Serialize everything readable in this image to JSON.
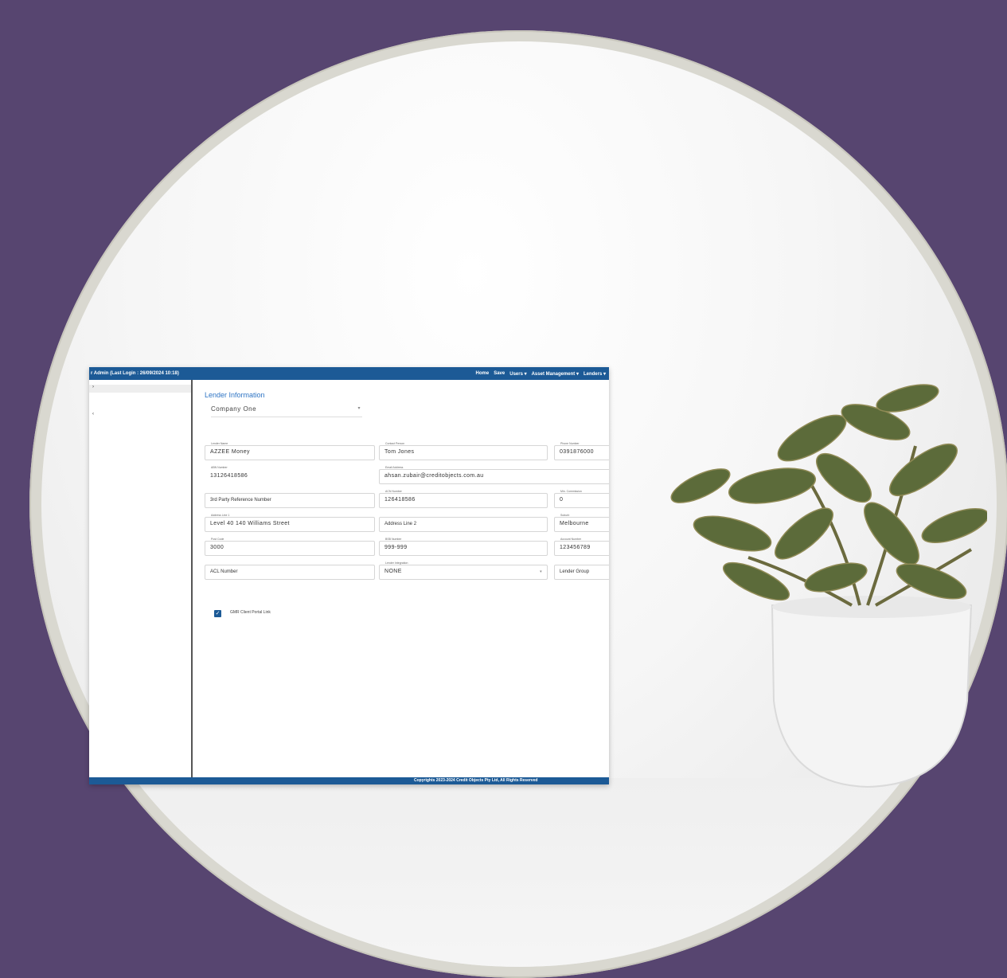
{
  "header": {
    "user_text": "r Admin   (Last Login : 26/09/2024 10:18)",
    "nav": [
      "Home",
      "Save",
      "Users ▾",
      "Asset Management ▾",
      "Lenders ▾"
    ]
  },
  "sidebar": {
    "items": [
      "›",
      "‹"
    ]
  },
  "page": {
    "title": "Lender Information",
    "company": "Company One"
  },
  "fields": {
    "lender_name": {
      "label": "Lender Name",
      "value": "AZZEE Money"
    },
    "contact_person": {
      "label": "Contact Person",
      "value": "Tom Jones"
    },
    "phone_number": {
      "label": "Phone Number",
      "value": "0391876000"
    },
    "abn_number": {
      "label": "ABN Number",
      "value": "13126418586"
    },
    "email_address": {
      "label": "Email Address",
      "value": "ahsan.zubair@creditobjects.com.au"
    },
    "third_party_ref": {
      "placeholder": "3rd Party Reference Number"
    },
    "acn_number": {
      "label": "ACN Number",
      "value": "126418586"
    },
    "min_commission": {
      "label": "Min. Commission",
      "value": "0"
    },
    "address_line_1": {
      "label": "Address Line 1",
      "value": "Level 40 140 Williams Street"
    },
    "address_line_2": {
      "placeholder": "Address Line 2"
    },
    "suburb": {
      "label": "Suburb",
      "value": "Melbourne"
    },
    "post_code": {
      "label": "Post Code",
      "value": "3000"
    },
    "bsb_number": {
      "label": "BSB Number",
      "value": "999-999"
    },
    "account_number": {
      "label": "Account Number",
      "value": "123456789"
    },
    "acl_number": {
      "placeholder": "ACL Number"
    },
    "lender_integration": {
      "label": "Lender Integration",
      "value": "NONE"
    },
    "lender_group": {
      "placeholder": "Lender Group"
    }
  },
  "checkbox": {
    "label": "GMR Client Portal Link",
    "checked": true
  },
  "footer": {
    "text": "Copyrights 2023-2024 Credit Objects Pty Ltd, All Rights Reserved"
  },
  "colors": {
    "background": "#574570",
    "brand_blue": "#1c5a96",
    "title_blue": "#2e74c4"
  }
}
